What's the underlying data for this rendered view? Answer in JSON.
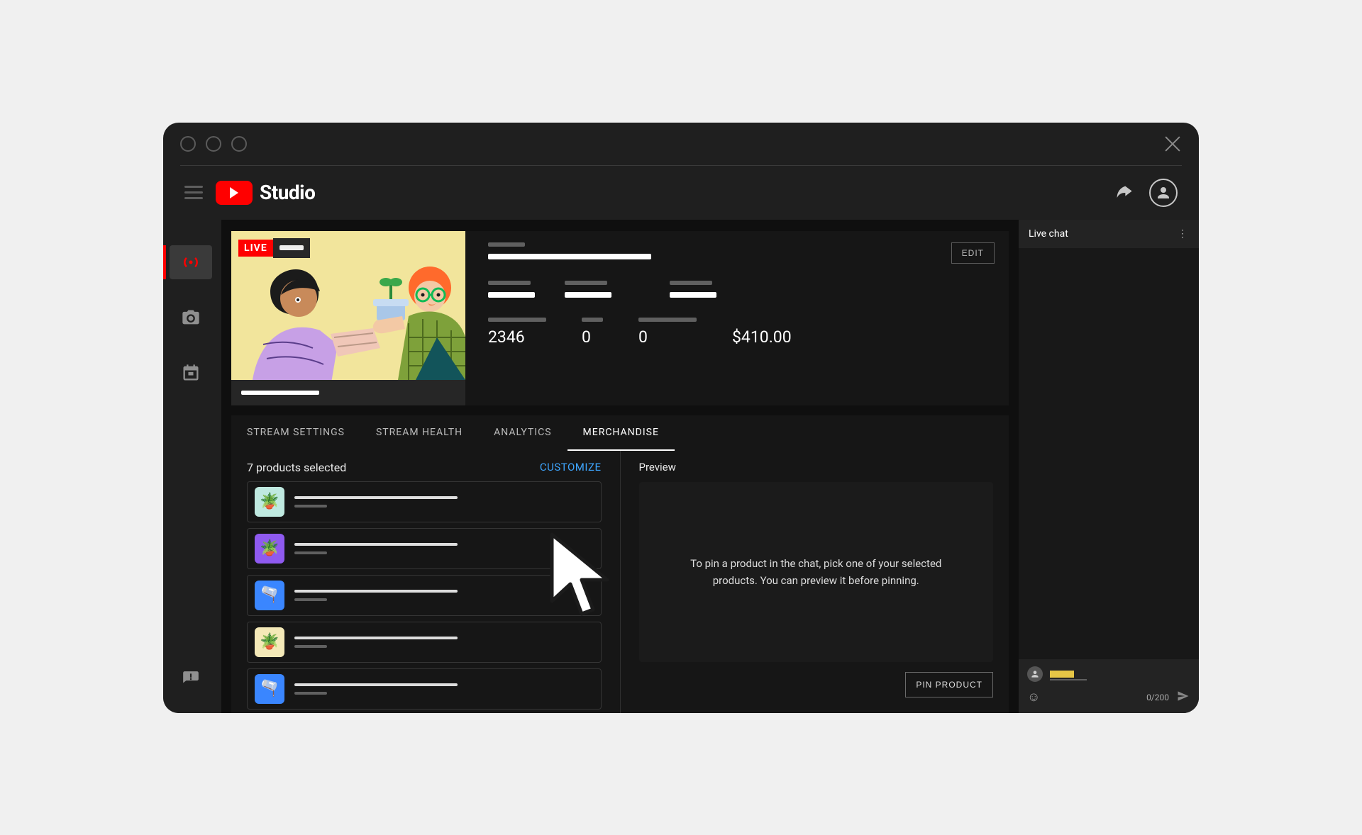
{
  "brand": {
    "name": "Studio"
  },
  "appbar": {
    "share_label": "share"
  },
  "stream": {
    "live_badge": "LIVE",
    "edit_label": "EDIT",
    "stats": {
      "stat1_value": "2346",
      "stat2_value": "0",
      "stat3_value": "0",
      "stat4_value": "$410.00"
    }
  },
  "tabs": [
    {
      "label": "STREAM SETTINGS"
    },
    {
      "label": "STREAM HEALTH"
    },
    {
      "label": "ANALYTICS"
    },
    {
      "label": "MERCHANDISE",
      "active": true
    }
  ],
  "merchandise": {
    "selected_label": "7 products selected",
    "customize_label": "CUSTOMIZE",
    "products": [
      {
        "color": "#bfe9e0",
        "emoji": "🪴"
      },
      {
        "color": "#8f5af0",
        "emoji": "🪴"
      },
      {
        "color": "#3a86ff",
        "emoji": "🫗"
      },
      {
        "color": "#f4e9b8",
        "emoji": "🪴"
      },
      {
        "color": "#3a86ff",
        "emoji": "🫗"
      }
    ],
    "preview_title": "Preview",
    "preview_text": "To pin a product in the chat, pick one of your selected products. You can preview it before pinning.",
    "pin_label": "PIN PRODUCT"
  },
  "chat": {
    "title": "Live chat",
    "counter": "0/200"
  }
}
